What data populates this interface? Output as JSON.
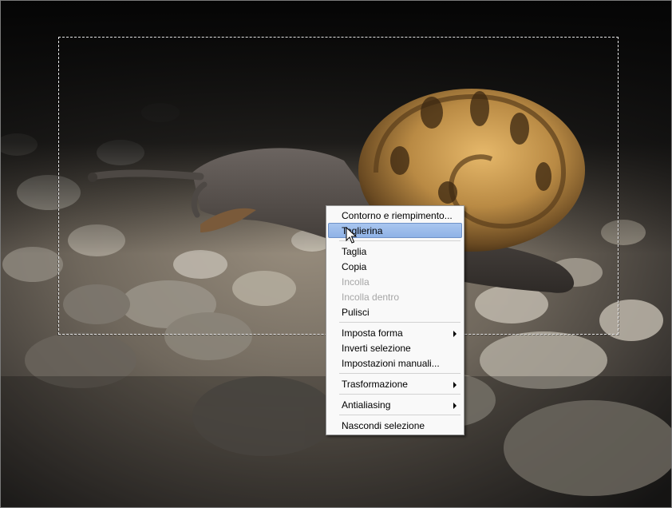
{
  "context_menu": {
    "items": [
      {
        "label": "Contorno e riempimento...",
        "state": "normal",
        "submenu": false
      },
      {
        "label": "Taglierina",
        "state": "highlighted",
        "submenu": false
      },
      {
        "separator": true
      },
      {
        "label": "Taglia",
        "state": "normal",
        "submenu": false
      },
      {
        "label": "Copia",
        "state": "normal",
        "submenu": false
      },
      {
        "label": "Incolla",
        "state": "disabled",
        "submenu": false
      },
      {
        "label": "Incolla dentro",
        "state": "disabled",
        "submenu": false
      },
      {
        "label": "Pulisci",
        "state": "normal",
        "submenu": false
      },
      {
        "separator": true
      },
      {
        "label": "Imposta forma",
        "state": "normal",
        "submenu": true
      },
      {
        "label": "Inverti selezione",
        "state": "normal",
        "submenu": false
      },
      {
        "label": "Impostazioni manuali...",
        "state": "normal",
        "submenu": false
      },
      {
        "separator": true
      },
      {
        "label": "Trasformazione",
        "state": "normal",
        "submenu": true
      },
      {
        "separator": true
      },
      {
        "label": "Antialiasing",
        "state": "normal",
        "submenu": true
      },
      {
        "separator": true
      },
      {
        "label": "Nascondi selezione",
        "state": "normal",
        "submenu": false
      }
    ]
  },
  "colors": {
    "menu_highlight": "#a9c6ef",
    "menu_disabled_text": "#a6a6a6",
    "selection_marquee": "#e8e8e8"
  },
  "icons": {
    "cursor": "arrow-pointer-icon",
    "submenu": "submenu-arrow-icon"
  }
}
